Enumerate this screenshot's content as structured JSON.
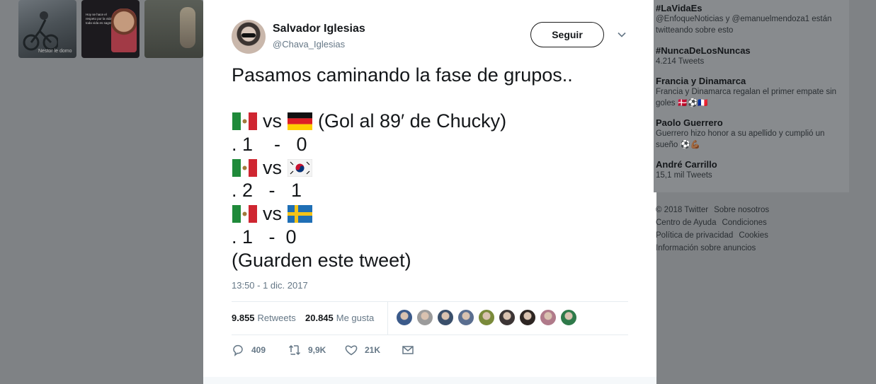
{
  "background_media": {
    "thumb1_caption": "Nestor le domo",
    "thumb2_text": "Hoy se hace el respeto por la vida, toda vida es sagrada"
  },
  "tweet": {
    "user_name": "Salvador Iglesias",
    "user_handle": "@Chava_Iglesias",
    "follow_label": "Seguir",
    "line1": "Pasamos caminando la fase de grupos..",
    "match1_vs": "vs",
    "match1_note": "(Gol al 89′ de Chucky)",
    "score1": ". 1    -   0",
    "match2_vs": "vs",
    "score2": ". 2   -   1",
    "match3_vs": "vs",
    "score3": ". 1   -  0",
    "closing": "(Guarden este tweet)",
    "timestamp": "13:50 - 1 dic. 2017",
    "retweets_count": "9.855",
    "retweets_label": "Retweets",
    "likes_count": "20.845",
    "likes_label": "Me gusta",
    "reply_count": "409",
    "retweet_action_count": "9,9K",
    "like_action_count": "21K"
  },
  "flags": {
    "team": "mexico-flag",
    "opponent1": "germany-flag",
    "opponent2": "south-korea-flag",
    "opponent3": "sweden-flag"
  },
  "trends": [
    {
      "name": "#LaVidaEs",
      "desc": "@EnfoqueNoticias y @emanuelmendoza1 están twitteando sobre esto"
    },
    {
      "name": "#NuncaDeLosNuncas",
      "desc": "4.214 Tweets"
    },
    {
      "name": "Francia y Dinamarca",
      "desc": "Francia y Dinamarca regalan el primer empate sin goles 🇩🇰⚽🇫🇷"
    },
    {
      "name": "Paolo Guerrero",
      "desc": "Guerrero hizo honor a su apellido y cumplió un sueño ⚽💪🏾"
    },
    {
      "name": "André Carrillo",
      "desc": "15,1 mil Tweets"
    }
  ],
  "footer_links": [
    "© 2018 Twitter",
    "Sobre nosotros",
    "Centro de Ayuda",
    "Condiciones",
    "Política de privacidad",
    "Cookies",
    "Información sobre anuncios"
  ],
  "colors": {
    "overlay": "#7f8285",
    "text_primary": "#14171a",
    "text_secondary": "#657786",
    "border": "#e6ecf0"
  },
  "likers": [
    "#3b5a8a",
    "#9b9b9b",
    "#3a4f6b",
    "#5a6e90",
    "#7a8a3a",
    "#3c3535",
    "#2d2522",
    "#b07a8a",
    "#2f7a4a"
  ]
}
